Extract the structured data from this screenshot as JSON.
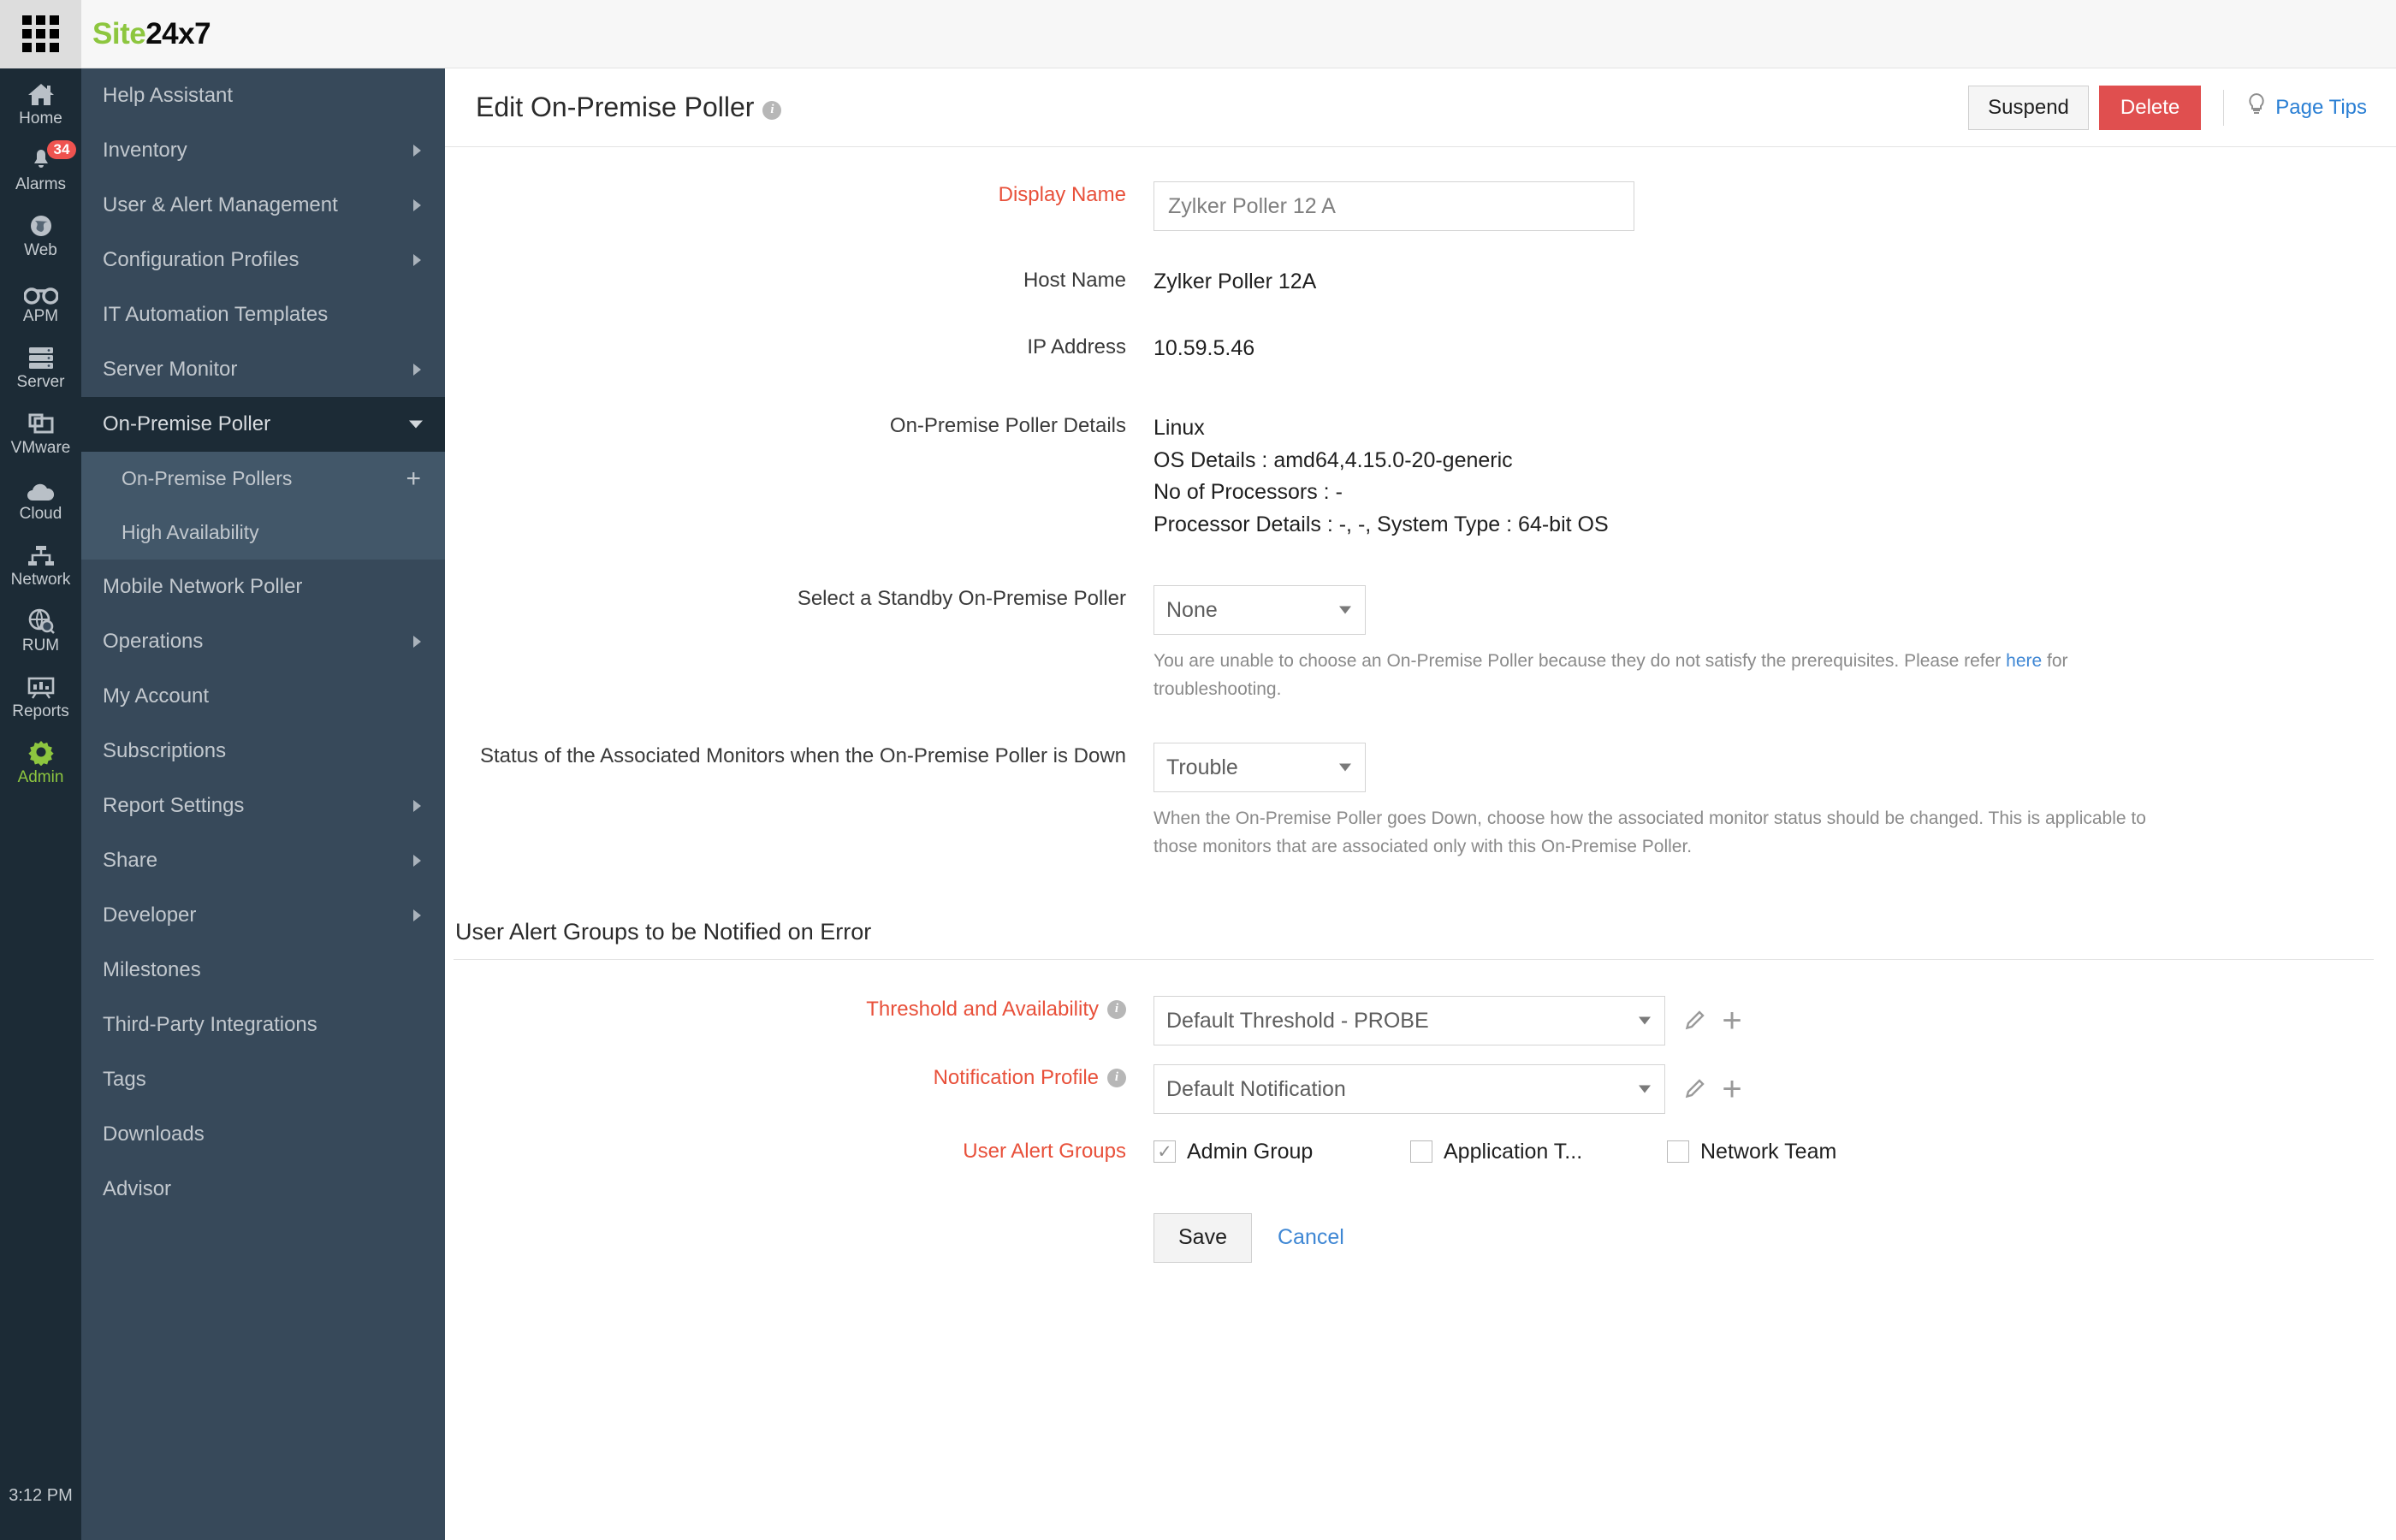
{
  "topbar": {
    "apps_icon": "grid-apps-icon",
    "brand_green": "Site",
    "brand_dark": "24x7",
    "brand_green_hex": "#8dc63f"
  },
  "icon_rail": {
    "clock": "3:12 PM",
    "items": [
      {
        "label": "Home",
        "icon": "home-icon",
        "badge": "",
        "active": false
      },
      {
        "label": "Alarms",
        "icon": "bell-icon",
        "badge": "34",
        "active": false
      },
      {
        "label": "Web",
        "icon": "globe-icon",
        "badge": "",
        "active": false
      },
      {
        "label": "APM",
        "icon": "binoculars-icon",
        "badge": "",
        "active": false
      },
      {
        "label": "Server",
        "icon": "server-icon",
        "badge": "",
        "active": false
      },
      {
        "label": "VMware",
        "icon": "windows-stack-icon",
        "badge": "",
        "active": false
      },
      {
        "label": "Cloud",
        "icon": "cloud-icon",
        "badge": "",
        "active": false
      },
      {
        "label": "Network",
        "icon": "network-icon",
        "badge": "",
        "active": false
      },
      {
        "label": "RUM",
        "icon": "globe-search-icon",
        "badge": "",
        "active": false
      },
      {
        "label": "Reports",
        "icon": "reports-icon",
        "badge": "",
        "active": false
      },
      {
        "label": "Admin",
        "icon": "gear-icon",
        "badge": "",
        "active": true
      }
    ]
  },
  "nav_menu": {
    "items": [
      {
        "label": "Help Assistant",
        "arrow": "none",
        "active": false
      },
      {
        "label": "Inventory",
        "arrow": "right",
        "active": false
      },
      {
        "label": "User & Alert Management",
        "arrow": "right",
        "active": false
      },
      {
        "label": "Configuration Profiles",
        "arrow": "right",
        "active": false
      },
      {
        "label": "IT Automation Templates",
        "arrow": "none",
        "active": false
      },
      {
        "label": "Server Monitor",
        "arrow": "right",
        "active": false
      },
      {
        "label": "On-Premise Poller",
        "arrow": "down",
        "active": true
      }
    ],
    "subitems": [
      {
        "label": "On-Premise Pollers",
        "plus": "+"
      },
      {
        "label": "High Availability",
        "plus": ""
      }
    ],
    "items_after": [
      {
        "label": "Mobile Network Poller",
        "arrow": "none",
        "active": false
      },
      {
        "label": "Operations",
        "arrow": "right",
        "active": false
      },
      {
        "label": "My Account",
        "arrow": "none",
        "active": false
      },
      {
        "label": "Subscriptions",
        "arrow": "none",
        "active": false
      },
      {
        "label": "Report Settings",
        "arrow": "right",
        "active": false
      },
      {
        "label": "Share",
        "arrow": "right",
        "active": false
      },
      {
        "label": "Developer",
        "arrow": "right",
        "active": false
      },
      {
        "label": "Milestones",
        "arrow": "none",
        "active": false
      },
      {
        "label": "Third-Party Integrations",
        "arrow": "none",
        "active": false
      },
      {
        "label": "Tags",
        "arrow": "none",
        "active": false
      },
      {
        "label": "Downloads",
        "arrow": "none",
        "active": false
      },
      {
        "label": "Advisor",
        "arrow": "none",
        "active": false
      }
    ]
  },
  "page": {
    "title": "Edit On-Premise Poller",
    "title_info_icon": "info-icon",
    "suspend_label": "Suspend",
    "delete_label": "Delete",
    "page_tips_label": "Page Tips",
    "page_tips_icon": "lightbulb-icon",
    "delete_color": "#e04f4f",
    "link_color": "#2a7fd4"
  },
  "form": {
    "display_name": {
      "label": "Display Name",
      "value": "Zylker Poller 12 A",
      "required": true
    },
    "host_name": {
      "label": "Host Name",
      "value": "Zylker Poller 12A"
    },
    "ip_address": {
      "label": "IP Address",
      "value": "10.59.5.46"
    },
    "poller_details": {
      "label": "On-Premise Poller Details",
      "lines": [
        "Linux",
        "OS Details : amd64,4.15.0-20-generic",
        "No of Processors : -",
        "Processor Details : -, -, System Type : 64-bit OS"
      ]
    },
    "standby_poller": {
      "label": "Select a Standby On-Premise Poller",
      "value": "None",
      "help_before": "You are unable to choose an On-Premise Poller because they do not satisfy the prerequisites. Please refer ",
      "help_link": "here",
      "help_after": " for troubleshooting."
    },
    "monitor_status": {
      "label": "Status of the Associated Monitors when the On-Premise Poller is Down",
      "value": "Trouble",
      "help": "When the On-Premise Poller goes Down, choose how the associated monitor status should be changed. This is applicable to those monitors that are associated only with this On-Premise Poller."
    }
  },
  "alert_section": {
    "title": "User Alert Groups to be Notified on Error",
    "threshold": {
      "label": "Threshold and Availability",
      "info_icon": "info-icon",
      "value": "Default Threshold - PROBE",
      "edit_icon": "pencil-icon",
      "add_icon": "plus-icon"
    },
    "notification": {
      "label": "Notification Profile",
      "info_icon": "info-icon",
      "value": "Default Notification",
      "edit_icon": "pencil-icon",
      "add_icon": "plus-icon"
    },
    "user_groups": {
      "label": "User Alert Groups",
      "options": [
        {
          "label": "Admin Group",
          "checked": true,
          "mark": "✓"
        },
        {
          "label": "Application T...",
          "checked": false,
          "mark": ""
        },
        {
          "label": "Network Team",
          "checked": false,
          "mark": ""
        }
      ]
    }
  },
  "footer": {
    "save_label": "Save",
    "cancel_label": "Cancel"
  }
}
